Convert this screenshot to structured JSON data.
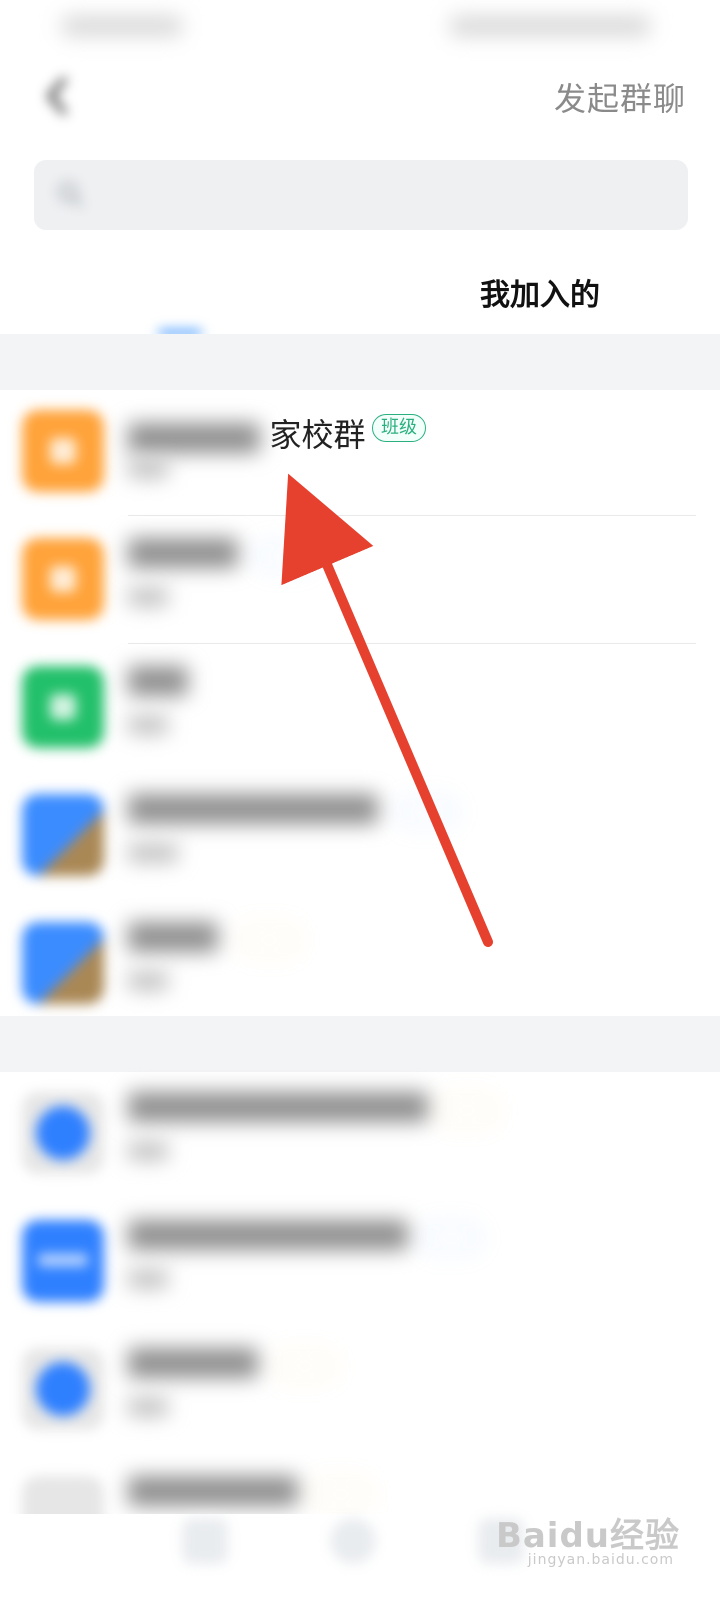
{
  "header": {
    "title": "",
    "start_group_chat": "发起群聊"
  },
  "search": {
    "placeholder": ""
  },
  "tabs": [
    {
      "label": ""
    },
    {
      "label": "我加入的"
    }
  ],
  "sections": [
    {
      "title": ""
    },
    {
      "title": ""
    }
  ],
  "rows": [
    {
      "name_suffix": "家校群",
      "badge": "班级",
      "avatar_color": "#ffa33a",
      "badge_color": "#2ab07f"
    },
    {
      "name_suffix": "",
      "badge": "",
      "avatar_color": "#ffa33a",
      "badge_color": "#7fb6ff"
    },
    {
      "name_suffix": "",
      "badge": "",
      "avatar_color": "#22c06a",
      "badge_color": "#7fb6ff"
    },
    {
      "name_suffix": "",
      "badge": "",
      "avatar_color": "#3b8cff",
      "badge_color": "#7fb6ff"
    },
    {
      "name_suffix": "",
      "badge": "",
      "avatar_color": "#3b8cff",
      "badge_color": "#ffd27a"
    },
    {
      "name_suffix": "",
      "badge": "",
      "avatar_color": "#2f80ff",
      "badge_color": "#ffd27a"
    },
    {
      "name_suffix": "",
      "badge": "",
      "avatar_color": "#2f80ff",
      "badge_color": "#7fb6ff"
    },
    {
      "name_suffix": "",
      "badge": "",
      "avatar_color": "#2f80ff",
      "badge_color": "#ffd27a"
    },
    {
      "name_suffix": "",
      "badge": "",
      "avatar_color": "#2f80ff",
      "badge_color": "#ffd27a"
    }
  ],
  "watermark": {
    "main": "Baidu经验",
    "sub": "jingyan.baidu.com"
  },
  "colors": {
    "accent_blue": "#2b8cff",
    "annotation_arrow": "#e6412e"
  }
}
